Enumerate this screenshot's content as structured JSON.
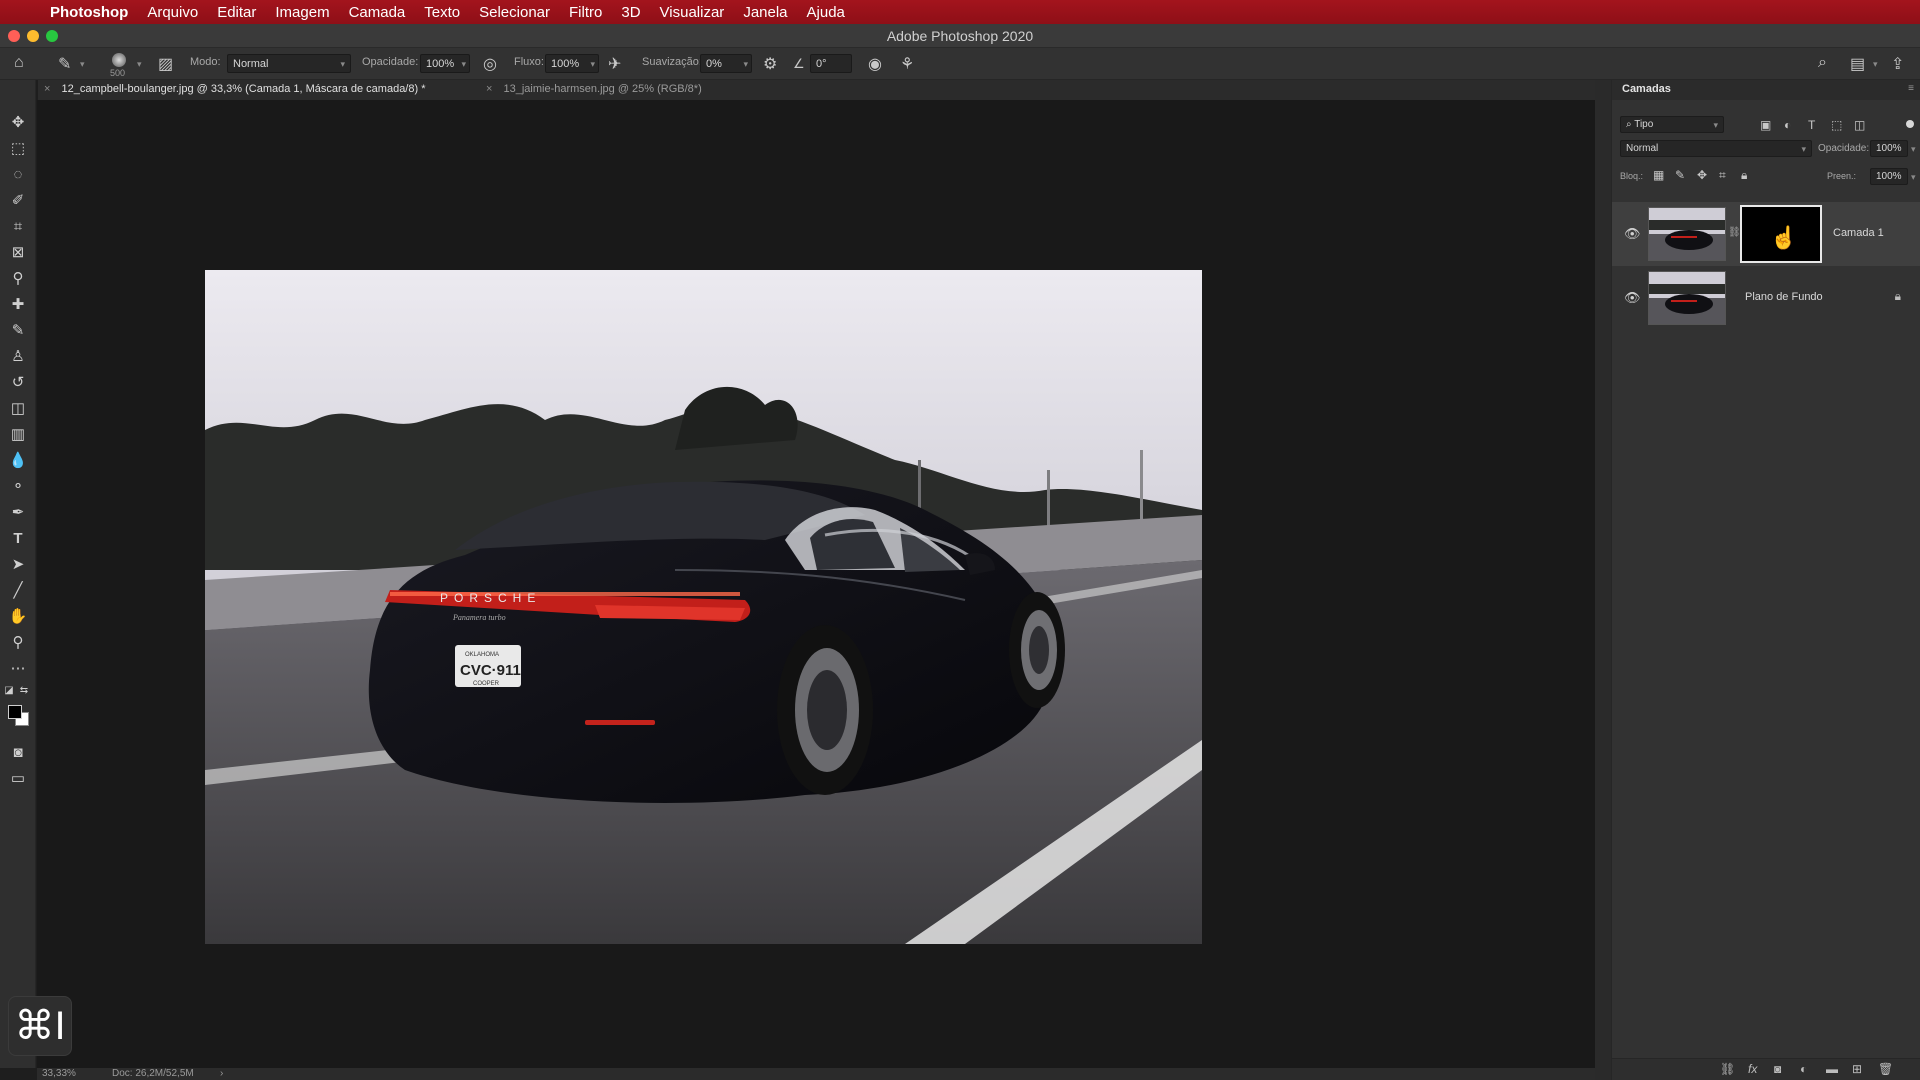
{
  "menubar": {
    "apple": "",
    "app": "Photoshop",
    "items": [
      "Arquivo",
      "Editar",
      "Imagem",
      "Camada",
      "Texto",
      "Selecionar",
      "Filtro",
      "3D",
      "Visualizar",
      "Janela",
      "Ajuda"
    ]
  },
  "window": {
    "title": "Adobe Photoshop 2020",
    "lights": [
      "#ff5f57",
      "#febc2e",
      "#28c840"
    ]
  },
  "options": {
    "brush_size": "500",
    "mode_label": "Modo:",
    "mode_value": "Normal",
    "opacity_label": "Opacidade:",
    "opacity_value": "100%",
    "flow_label": "Fluxo:",
    "flow_value": "100%",
    "smoothing_label": "Suavização:",
    "smoothing_value": "0%",
    "angle_value": "0°"
  },
  "tabs": [
    {
      "label": "12_campbell-boulanger.jpg @ 33,3% (Camada 1, Máscara de camada/8) *",
      "active": true
    },
    {
      "label": "13_jaimie-harmsen.jpg @ 25% (RGB/8*)",
      "active": false
    }
  ],
  "tools": [
    "move-tool",
    "marquee-tool",
    "lasso-tool",
    "quick-selection-tool",
    "crop-tool",
    "frame-tool",
    "eyedropper-tool",
    "healing-brush-tool",
    "brush-tool",
    "clone-stamp-tool",
    "history-brush-tool",
    "eraser-tool",
    "gradient-tool",
    "blur-tool",
    "dodge-tool",
    "pen-tool",
    "type-tool",
    "path-selection-tool",
    "line-tool",
    "hand-tool",
    "zoom-tool",
    "more-tools"
  ],
  "colors": {
    "foreground": "#000000",
    "background": "#ffffff",
    "accent": "#8e0f17"
  },
  "photo": {
    "plate_text": "CVC·911",
    "plate_state": "OKLAHOMA",
    "plate_bottom": "COOPER",
    "brand_text": "PORSCHE",
    "model_text": "Panamera turbo"
  },
  "status": {
    "zoom": "33,33%",
    "doc": "Doc: 26,2M/52,5M",
    "arrow": "›"
  },
  "shortcut_overlay": "⌘I",
  "layers_panel": {
    "title": "Camadas",
    "filter_label": "Tipo",
    "blend_mode": "Normal",
    "opacity_label": "Opacidade:",
    "opacity_value": "100%",
    "lock_label": "Bloq.:",
    "fill_label": "Preen.:",
    "fill_value": "100%",
    "layers": [
      {
        "name": "Camada 1",
        "selected": true,
        "has_mask": true
      },
      {
        "name": "Plano de Fundo",
        "selected": false,
        "locked": true
      }
    ]
  }
}
